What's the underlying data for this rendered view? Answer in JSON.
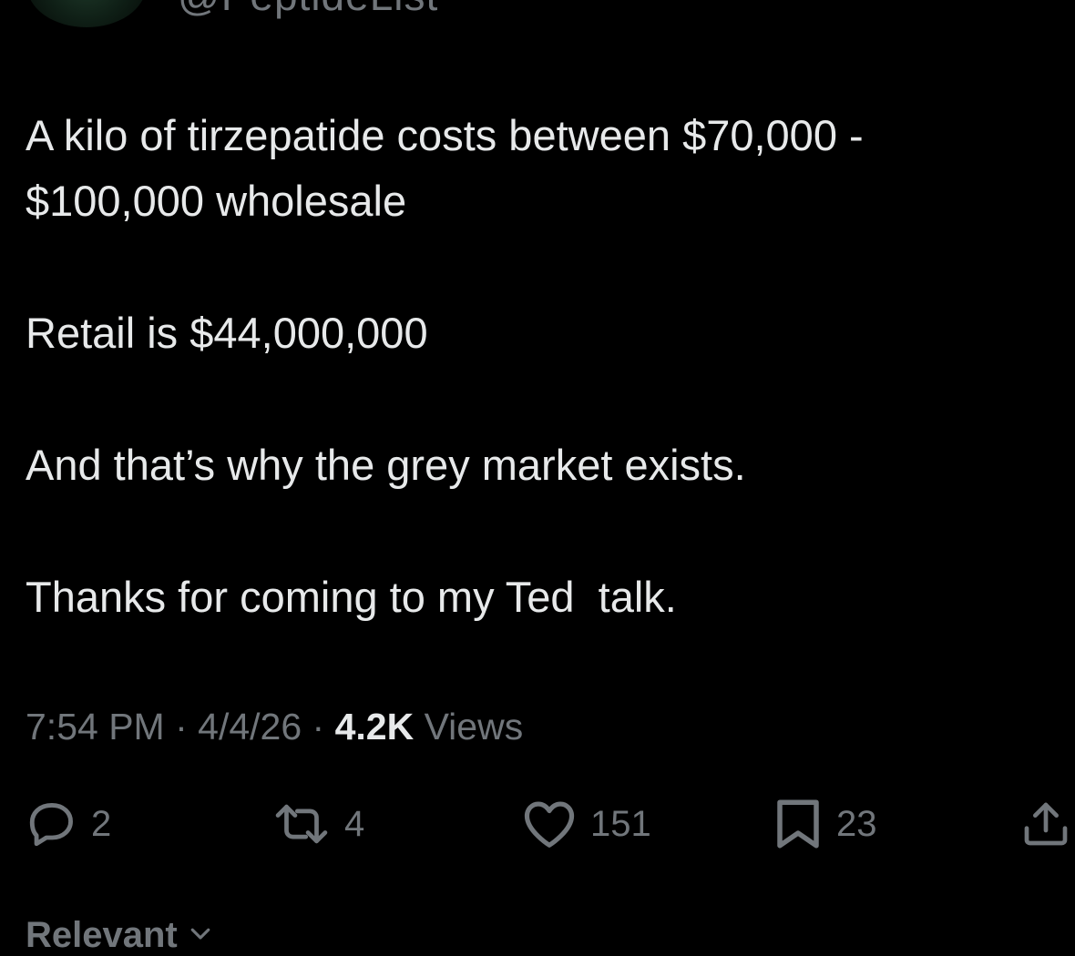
{
  "author": {
    "handle": "@PeptideList"
  },
  "tweet": {
    "paragraphs": [
      "A kilo of tirzepatide costs between $70,000 -\n$100,000 wholesale",
      "Retail is $44,000,000",
      "And that’s why the grey market exists.",
      "Thanks for coming to my Ted  talk."
    ],
    "time": "7:54 PM",
    "sep1": " · ",
    "date": "4/4/26",
    "sep2": " · ",
    "views_count": "4.2K",
    "views_label": " Views"
  },
  "actions": {
    "replies": "2",
    "reposts": "4",
    "likes": "151",
    "bookmarks": "23"
  },
  "sort": {
    "label": "Relevant"
  },
  "icons": {
    "reply": "reply-icon",
    "repost": "repost-icon",
    "like": "heart-icon",
    "bookmark": "bookmark-icon",
    "share": "share-icon",
    "chevron": "chevron-down-icon"
  },
  "colors": {
    "background": "#000000",
    "text": "#e7e9ea",
    "muted": "#71767b"
  }
}
